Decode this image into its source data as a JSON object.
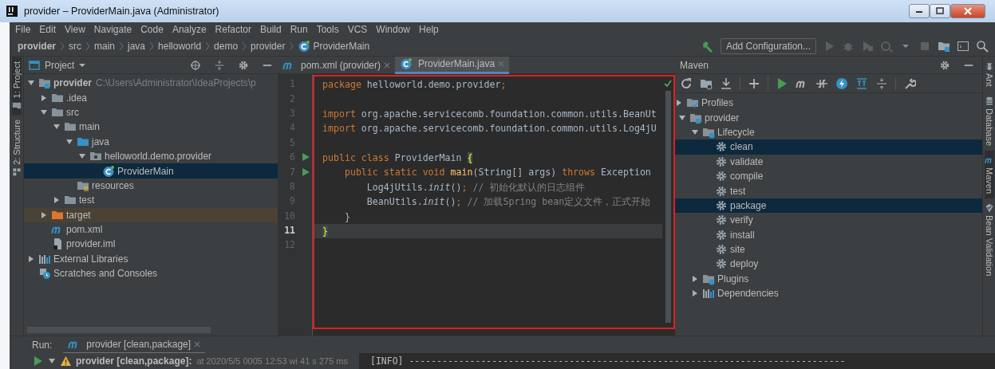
{
  "window": {
    "title": "provider – ProviderMain.java (Administrator)"
  },
  "menu": [
    "File",
    "Edit",
    "View",
    "Navigate",
    "Code",
    "Analyze",
    "Refactor",
    "Build",
    "Run",
    "Tools",
    "VCS",
    "Window",
    "Help"
  ],
  "breadcrumb": [
    {
      "label": "provider",
      "kind": "module"
    },
    {
      "label": "src",
      "kind": "plain"
    },
    {
      "label": "main",
      "kind": "plain"
    },
    {
      "label": "java",
      "kind": "plain"
    },
    {
      "label": "helloworld",
      "kind": "plain"
    },
    {
      "label": "demo",
      "kind": "plain"
    },
    {
      "label": "provider",
      "kind": "plain"
    },
    {
      "label": "ProviderMain",
      "kind": "class"
    }
  ],
  "toolbar": {
    "config_button": "Add Configuration..."
  },
  "left_strip": [
    {
      "label": "1: Project",
      "kind": "folder",
      "selected": true
    },
    {
      "label": "2: Structure",
      "kind": "structure",
      "selected": false
    }
  ],
  "project_panel": {
    "title": "Project",
    "tree": [
      {
        "label": "provider",
        "note": "C:\\Users\\Administrator\\IdeaProjects\\p",
        "kind": "module",
        "expanded": true,
        "selected": false,
        "children": [
          {
            "label": ".idea",
            "kind": "folder",
            "expanded": false,
            "selected": false
          },
          {
            "label": "src",
            "kind": "folder",
            "expanded": true,
            "selected": false,
            "children": [
              {
                "label": "main",
                "kind": "folder",
                "expanded": true,
                "selected": false,
                "children": [
                  {
                    "label": "java",
                    "kind": "source",
                    "expanded": true,
                    "selected": false,
                    "children": [
                      {
                        "label": "helloworld.demo.provider",
                        "kind": "package",
                        "expanded": true,
                        "selected": false,
                        "children": [
                          {
                            "label": "ProviderMain",
                            "kind": "class",
                            "selected": true
                          }
                        ]
                      }
                    ]
                  },
                  {
                    "label": "resources",
                    "kind": "resources",
                    "selected": false
                  }
                ]
              },
              {
                "label": "test",
                "kind": "folder",
                "expanded": false,
                "selected": false
              }
            ]
          },
          {
            "label": "target",
            "kind": "excluded",
            "expanded": false,
            "selected": false
          },
          {
            "label": "pom.xml",
            "kind": "maven",
            "selected": false
          },
          {
            "label": "provider.iml",
            "kind": "iml",
            "selected": false
          }
        ]
      },
      {
        "label": "External Libraries",
        "kind": "libraries",
        "expanded": false,
        "selected": false
      },
      {
        "label": "Scratches and Consoles",
        "kind": "scratches",
        "selected": false
      }
    ]
  },
  "editor": {
    "tabs": [
      {
        "label": "pom.xml (provider)",
        "kind": "maven",
        "selected": false
      },
      {
        "label": "ProviderMain.java",
        "kind": "class",
        "selected": true
      }
    ],
    "lines": [
      {
        "number": "1",
        "runnable": false,
        "current": false,
        "tokens": [
          {
            "text": "package",
            "kind": "keyword"
          },
          {
            "text": " helloworld.demo.provider",
            "kind": "plain"
          },
          {
            "text": ";",
            "kind": "keyword"
          }
        ]
      },
      {
        "number": "2",
        "runnable": false,
        "current": false
      },
      {
        "number": "3",
        "runnable": false,
        "current": false,
        "tokens": [
          {
            "text": "import",
            "kind": "keyword"
          },
          {
            "text": " org.apache.servicecomb.foundation.common.utils.BeanUt",
            "kind": "plain"
          }
        ]
      },
      {
        "number": "4",
        "runnable": false,
        "current": false,
        "tokens": [
          {
            "text": "import",
            "kind": "keyword"
          },
          {
            "text": " org.apache.servicecomb.foundation.common.utils.Log4jU",
            "kind": "plain"
          }
        ]
      },
      {
        "number": "5",
        "runnable": false,
        "current": false
      },
      {
        "number": "6",
        "runnable": true,
        "current": false,
        "tokens": [
          {
            "text": "public class",
            "kind": "keyword"
          },
          {
            "text": " ProviderMain ",
            "kind": "plain"
          },
          {
            "text": "{",
            "kind": "brace-match"
          }
        ]
      },
      {
        "number": "7",
        "runnable": true,
        "current": false,
        "tokens": [
          {
            "text": "    public static void ",
            "kind": "keyword"
          },
          {
            "text": "main",
            "kind": "method"
          },
          {
            "text": "(String[] args) ",
            "kind": "plain"
          },
          {
            "text": "throws",
            "kind": "keyword"
          },
          {
            "text": " Exception",
            "kind": "plain"
          }
        ]
      },
      {
        "number": "8",
        "runnable": false,
        "current": false,
        "tokens": [
          {
            "text": "        Log4jUtils.",
            "kind": "plain"
          },
          {
            "text": "init",
            "kind": "static"
          },
          {
            "text": "()",
            "kind": "plain"
          },
          {
            "text": ";",
            "kind": "keyword"
          },
          {
            "text": " // 初始化默认的日志组件",
            "kind": "comment"
          }
        ]
      },
      {
        "number": "9",
        "runnable": false,
        "current": false,
        "tokens": [
          {
            "text": "        BeanUtils.",
            "kind": "plain"
          },
          {
            "text": "init",
            "kind": "static"
          },
          {
            "text": "()",
            "kind": "plain"
          },
          {
            "text": ";",
            "kind": "keyword"
          },
          {
            "text": " // 加载Spring bean定义文件，正式开始",
            "kind": "comment"
          }
        ]
      },
      {
        "number": "10",
        "runnable": false,
        "current": false,
        "tokens": [
          {
            "text": "    }",
            "kind": "plain"
          }
        ]
      },
      {
        "number": "11",
        "runnable": false,
        "current": true,
        "tokens": [
          {
            "text": "}",
            "kind": "brace-match"
          }
        ]
      },
      {
        "number": "12",
        "runnable": false,
        "current": false
      }
    ]
  },
  "maven_panel": {
    "title": "Maven",
    "tree": [
      {
        "label": "Profiles",
        "kind": "profiles",
        "expanded": false,
        "selected": false
      },
      {
        "label": "provider",
        "kind": "module",
        "expanded": true,
        "selected": false,
        "children": [
          {
            "label": "Lifecycle",
            "kind": "lifecycle",
            "expanded": true,
            "selected": false,
            "children": [
              {
                "label": "clean",
                "kind": "goal",
                "selected": true
              },
              {
                "label": "validate",
                "kind": "goal",
                "selected": false
              },
              {
                "label": "compile",
                "kind": "goal",
                "selected": false
              },
              {
                "label": "test",
                "kind": "goal",
                "selected": false
              },
              {
                "label": "package",
                "kind": "goal",
                "selected": true
              },
              {
                "label": "verify",
                "kind": "goal",
                "selected": false
              },
              {
                "label": "install",
                "kind": "goal",
                "selected": false
              },
              {
                "label": "site",
                "kind": "goal",
                "selected": false
              },
              {
                "label": "deploy",
                "kind": "goal",
                "selected": false
              }
            ]
          },
          {
            "label": "Plugins",
            "kind": "lifecycle",
            "expanded": false,
            "selected": false
          },
          {
            "label": "Dependencies",
            "kind": "libraries",
            "expanded": false,
            "selected": false
          }
        ]
      }
    ]
  },
  "right_strip": [
    {
      "label": "Ant",
      "kind": "ant",
      "selected": false
    },
    {
      "label": "Database",
      "kind": "database",
      "selected": false
    },
    {
      "label": "Maven",
      "kind": "maven",
      "selected": true
    },
    {
      "label": "Bean Validation",
      "kind": "bean",
      "selected": false
    }
  ],
  "run_panel": {
    "label": "Run:",
    "tab": {
      "label": "provider [clean,package]",
      "selected": true
    },
    "task": {
      "name": "provider [clean,package]:",
      "detail": "at 2020/5/5 0005 12:53 wi 41 s 275 ms"
    },
    "console": "[INFO] -------------------------------------------------------------------------------"
  }
}
